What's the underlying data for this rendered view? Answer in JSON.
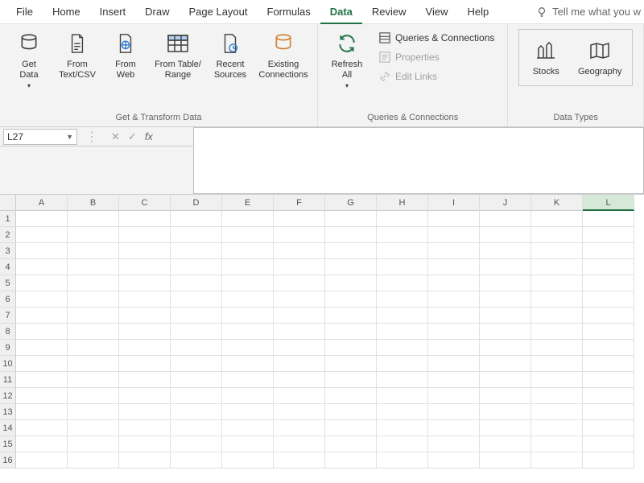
{
  "tabs": {
    "file": "File",
    "home": "Home",
    "insert": "Insert",
    "draw": "Draw",
    "pagelayout": "Page Layout",
    "formulas": "Formulas",
    "data": "Data",
    "review": "Review",
    "view": "View",
    "help": "Help"
  },
  "tellme": "Tell me what you w",
  "ribbon": {
    "getTransform": {
      "label": "Get & Transform Data",
      "getData": "Get\nData",
      "fromTextCsv": "From\nText/CSV",
      "fromWeb": "From\nWeb",
      "fromTableRange": "From Table/\nRange",
      "recentSources": "Recent\nSources",
      "existingConnections": "Existing\nConnections"
    },
    "queries": {
      "label": "Queries & Connections",
      "refreshAll": "Refresh\nAll",
      "queriesConnections": "Queries & Connections",
      "properties": "Properties",
      "editLinks": "Edit Links"
    },
    "dataTypes": {
      "label": "Data Types",
      "stocks": "Stocks",
      "geography": "Geography"
    }
  },
  "namebox": "L27",
  "columns": [
    "A",
    "B",
    "C",
    "D",
    "E",
    "F",
    "G",
    "H",
    "I",
    "J",
    "K",
    "L"
  ],
  "selectedCol": "L",
  "rows": [
    1,
    2,
    3,
    4,
    5,
    6,
    7,
    8,
    9,
    10,
    11,
    12,
    13,
    14,
    15,
    16
  ]
}
